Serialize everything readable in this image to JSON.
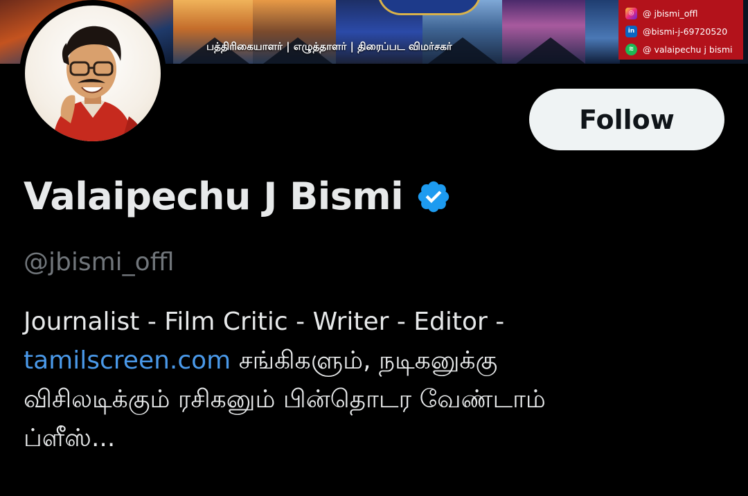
{
  "banner": {
    "tagline": "பத்திரிகையாளர் | எழுத்தாளர் | திரைப்பட விமர்சகர்",
    "social": [
      {
        "icon": "instagram-icon",
        "text": "@ jbismi_offl"
      },
      {
        "icon": "linkedin-icon",
        "text": "@bismi-j-69720520"
      },
      {
        "icon": "spotify-icon",
        "text": "@ valaipechu j bismi"
      }
    ]
  },
  "profile": {
    "name": "Valaipechu J Bismi",
    "handle": "@jbismi_offl",
    "verified": true,
    "follow_label": "Follow",
    "bio": {
      "line1": "Journalist - Film Critic - Writer - Editor -",
      "link": "tamilscreen.com",
      "line2_rest": " சங்கிகளும், நடிகனுக்கு",
      "line3": "விசிலடிக்கும் ரசிகனும் பின்தொடர வேண்டாம்",
      "line4": "ப்ளீஸ்..."
    }
  },
  "colors": {
    "background": "#000000",
    "text_primary": "#e7e9ea",
    "text_secondary": "#71767b",
    "link": "#4a99e9",
    "verified": "#1d9bf0",
    "follow_bg": "#eff3f4"
  }
}
